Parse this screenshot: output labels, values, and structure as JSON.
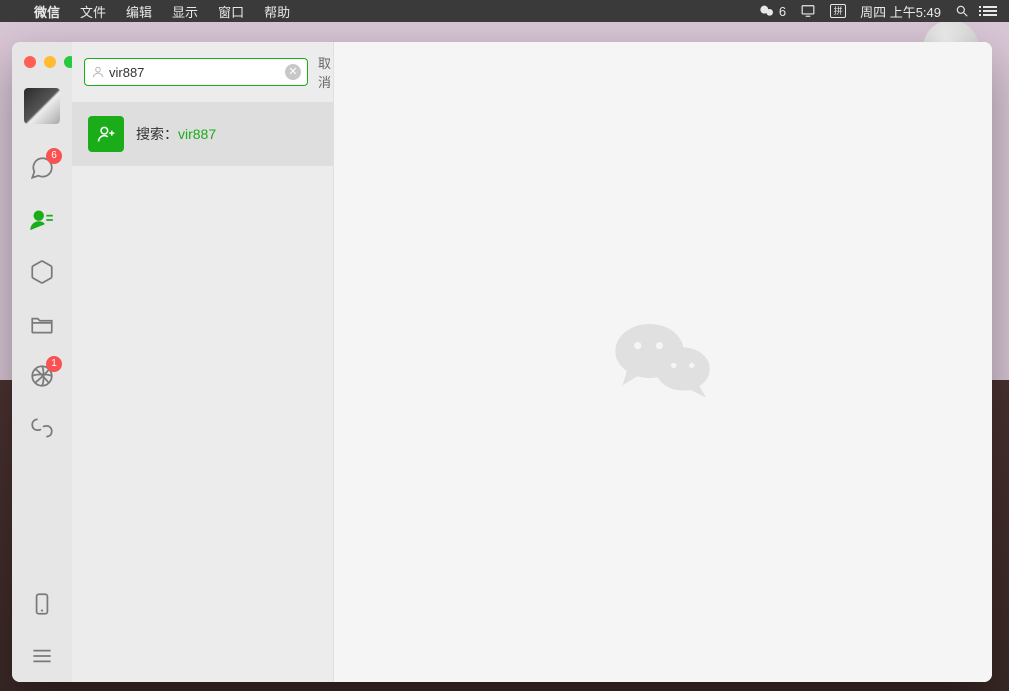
{
  "menubar": {
    "app_name": "微信",
    "items": [
      "文件",
      "编辑",
      "显示",
      "窗口",
      "帮助"
    ],
    "wechat_count": "6",
    "ime_label": "拼",
    "datetime": "周四 上午5:49"
  },
  "nav": {
    "chat_badge": "6",
    "moments_badge": "1"
  },
  "search": {
    "value": "vir887",
    "cancel": "取消",
    "result_prefix": "搜索：",
    "result_query": "vir887"
  }
}
